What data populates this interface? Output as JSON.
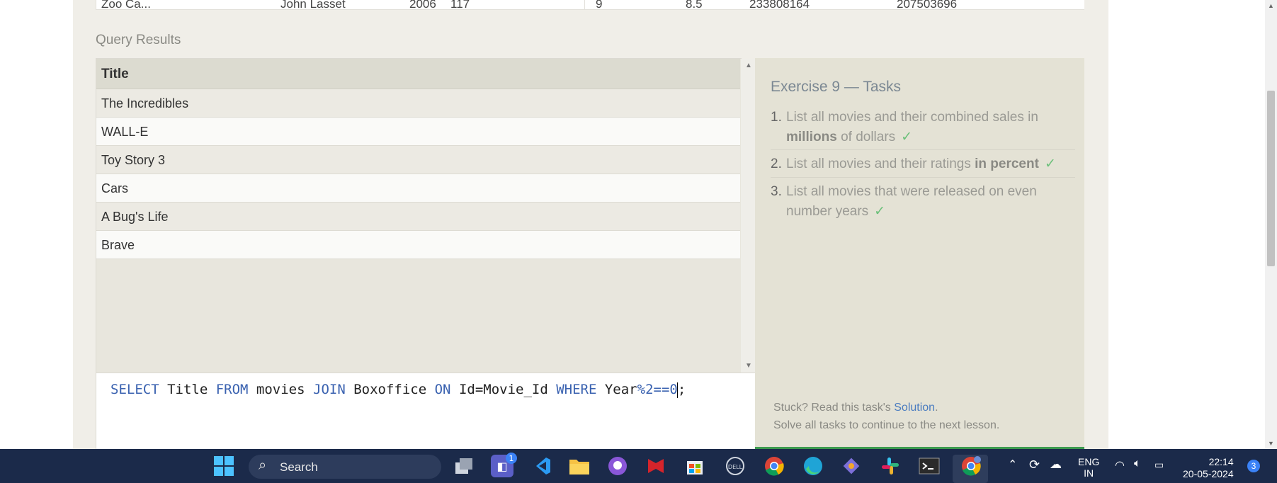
{
  "top_table": {
    "left_cells": [
      "Zoo Ca...",
      "John Lasset",
      "2006",
      "117"
    ],
    "right_cells": [
      "9",
      "8.5",
      "233808164",
      "207503696"
    ]
  },
  "query_results": {
    "label": "Query Results",
    "column_header": "Title",
    "rows": [
      "The Incredibles",
      "WALL-E",
      "Toy Story 3",
      "Cars",
      "A Bug's Life",
      "Brave"
    ]
  },
  "editor": {
    "tokens": {
      "select": "SELECT",
      "title": " Title ",
      "from": "FROM",
      "movies": " movies ",
      "join": "JOIN",
      "boxoffice": " Boxoffice ",
      "on": "ON",
      "cond": " Id=Movie_Id ",
      "where": "WHERE",
      "year": " Year",
      "expr": "%2==0",
      "end": ";"
    }
  },
  "tasks": {
    "title": "Exercise 9 — Tasks",
    "items": [
      {
        "num": "1.",
        "pre": "List all movies and their combined sales in ",
        "bold": "millions",
        "post": " of dollars",
        "check": "✓"
      },
      {
        "num": "2.",
        "pre": "List all movies and their ratings ",
        "bold": "in percent",
        "post": "",
        "check": "✓"
      },
      {
        "num": "3.",
        "pre": "List all movies that were released on even number years",
        "bold": "",
        "post": "",
        "check": "✓"
      }
    ],
    "stuck_text": "Stuck? Read this task's ",
    "solution_link": "Solution",
    "stuck_end": ".",
    "continue_text": "Solve all tasks to continue to the next lesson."
  },
  "taskbar": {
    "search_label": "Search",
    "teams_badge": "1",
    "lang_line1": "ENG",
    "lang_line2": "IN",
    "time": "22:14",
    "date": "20-05-2024",
    "notification_count": "3"
  },
  "colors": {
    "keyword": "#3a62b0",
    "check": "#6cc07a",
    "taskbar": "#1b2a4a",
    "link": "#4a7cc0"
  }
}
